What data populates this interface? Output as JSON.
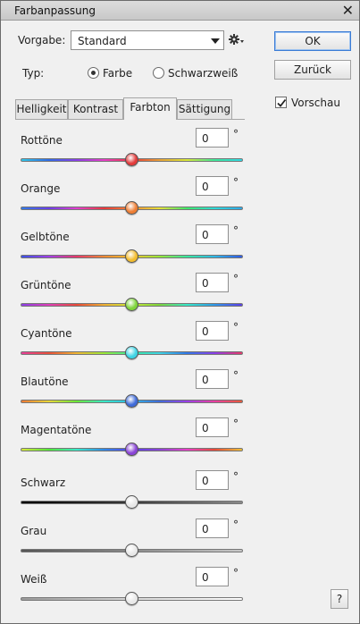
{
  "window": {
    "title": "Farbanpassung",
    "close_icon": "close-icon"
  },
  "preset": {
    "label": "Vorgabe:",
    "value": "Standard"
  },
  "type": {
    "label": "Typ:",
    "options": [
      "Farbe",
      "Schwarzweiß"
    ],
    "selected": "Farbe"
  },
  "buttons": {
    "ok": "OK",
    "back": "Zurück",
    "help": "?"
  },
  "preview": {
    "label": "Vorschau",
    "checked": true
  },
  "tabs": [
    "Helligkeit",
    "Kontrast",
    "Farbton",
    "Sättigung"
  ],
  "active_tab": "Farbton",
  "unit": "°",
  "sliders": [
    {
      "label": "Rottöne",
      "value": "0",
      "level": 0.5,
      "thumb_color": "#e23a3a"
    },
    {
      "label": "Orange",
      "value": "0",
      "level": 0.5,
      "thumb_color": "#ef7e34"
    },
    {
      "label": "Gelbtöne",
      "value": "0",
      "level": 0.5,
      "thumb_color": "#f3bd2f"
    },
    {
      "label": "Grüntöne",
      "value": "0",
      "level": 0.5,
      "thumb_color": "#7ed43b"
    },
    {
      "label": "Cyantöne",
      "value": "0",
      "level": 0.5,
      "thumb_color": "#3fd4e4"
    },
    {
      "label": "Blautöne",
      "value": "0",
      "level": 0.5,
      "thumb_color": "#3f6bd9"
    },
    {
      "label": "Magentatöne",
      "value": "0",
      "level": 0.5,
      "thumb_color": "#8a44d6"
    },
    {
      "label": "Schwarz",
      "value": "0",
      "level": 0.5,
      "thumb_color": "#e8e8e8"
    },
    {
      "label": "Grau",
      "value": "0",
      "level": 0.5,
      "thumb_color": "#e8e8e8"
    },
    {
      "label": "Weiß",
      "value": "0",
      "level": 0.5,
      "thumb_color": "#e8e8e8"
    }
  ]
}
